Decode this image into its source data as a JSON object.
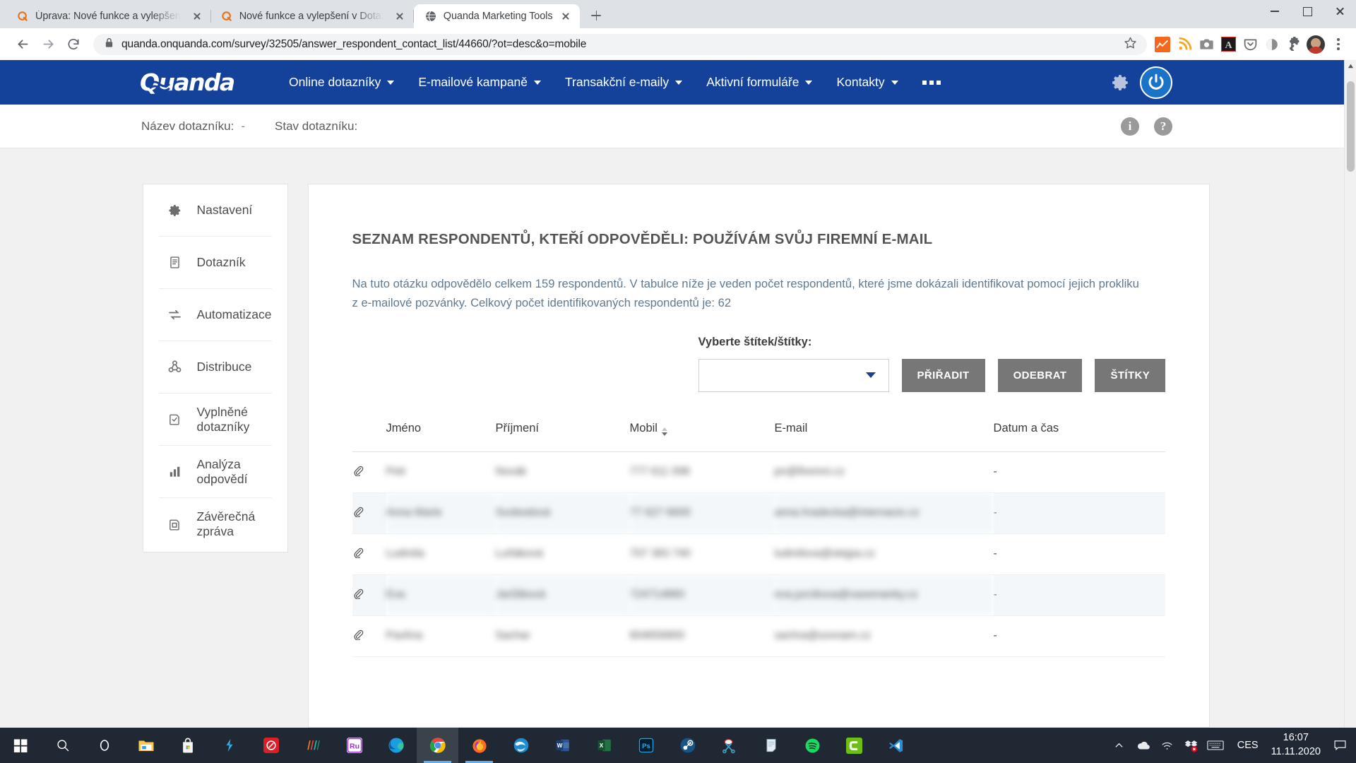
{
  "browser": {
    "tabs": [
      {
        "title": "Úprava: Nové funkce a vylepšení",
        "favicon": "quanda-favicon",
        "active": false
      },
      {
        "title": "Nové funkce a vylepšení v Dotaz",
        "favicon": "quanda-favicon",
        "active": false
      },
      {
        "title": "Quanda Marketing Tools",
        "favicon": "globe-favicon",
        "active": true
      }
    ],
    "new_tab_label": "+",
    "url": "quanda.onquanda.com/survey/32505/answer_respondent_contact_list/44660/?ot=desc&o=mobile",
    "url_host": "quanda.onquanda.com",
    "extensions": [
      "analytics-icon",
      "rss-icon",
      "camera-icon",
      "adobe-acrobat-icon",
      "pocket-icon",
      "moon-icon",
      "puzzle-extensions-icon",
      "profile-avatar-icon",
      "chrome-menu-icon"
    ],
    "window_controls": [
      "minimize",
      "maximize",
      "close"
    ]
  },
  "app": {
    "logo": "Quanda",
    "nav_items": [
      {
        "label": "Online dotazníky",
        "has_dropdown": true
      },
      {
        "label": "E-mailové kampaně",
        "has_dropdown": true
      },
      {
        "label": "Transakční e-maily",
        "has_dropdown": true
      },
      {
        "label": "Aktivní formuláře",
        "has_dropdown": true
      },
      {
        "label": "Kontakty",
        "has_dropdown": true
      },
      {
        "label": "•••",
        "has_dropdown": false
      }
    ],
    "nav_right": [
      "gear-icon",
      "user-power-avatar"
    ],
    "accent_color": "#14429a"
  },
  "subheader": {
    "survey_name_label": "Název dotazníku:",
    "survey_name_value": "-",
    "survey_state_label": "Stav dotazníku:",
    "survey_state_value": "",
    "info_icon": "i",
    "help_icon": "?"
  },
  "sidebar": {
    "items": [
      {
        "label": "Nastavení",
        "icon": "gear-icon"
      },
      {
        "label": "Dotazník",
        "icon": "document-icon"
      },
      {
        "label": "Automatizace",
        "icon": "refresh-cycle-icon"
      },
      {
        "label": "Distribuce",
        "icon": "share-nodes-icon"
      },
      {
        "label": "Vyplněné dotazníky",
        "icon": "checked-document-icon"
      },
      {
        "label": "Analýza odpovědí",
        "icon": "bar-chart-icon"
      },
      {
        "label": "Závěrečná zpráva",
        "icon": "report-document-icon"
      }
    ]
  },
  "main": {
    "title": "SEZNAM RESPONDENTŮ, KTEŘÍ ODPOVĚDĚLI: POUŽÍVÁM SVŮJ FIREMNÍ E-MAIL",
    "description": "Na tuto otázku odpovědělo celkem 159 respondentů. V tabulce níže je veden počet respondentů, které jsme dokázali identifikovat pomocí jejich prokliku z e-mailové pozvánky. Celkový počet identifikovaných respondentů je: 62",
    "total_respondents": "159",
    "identified_respondents": "62",
    "tags": {
      "label": "Vyberte štítek/štítky:",
      "select_value": "",
      "select_placeholder": "",
      "buttons": [
        {
          "label": "PŘIŘADIT",
          "name": "assign-tag-button"
        },
        {
          "label": "ODEBRAT",
          "name": "remove-tag-button"
        },
        {
          "label": "ŠTÍTKY",
          "name": "tags-button"
        }
      ]
    },
    "table": {
      "columns": [
        "",
        "Jméno",
        "Příjmení",
        "Mobil",
        "E-mail",
        "Datum a čas"
      ],
      "sorted_column": "Mobil",
      "sort_direction": "desc",
      "rows": [
        {
          "attach": "paperclip-icon",
          "jmeno": "Petr",
          "prijmeni": "Novák",
          "mobil": "777 611 098",
          "email": "pn@firemni.cz",
          "datum": "-"
        },
        {
          "attach": "paperclip-icon",
          "jmeno": "Anna Marie",
          "prijmeni": "Svobodová",
          "mobil": "77 627 6600",
          "email": "anna.hradecka@internacio.cz",
          "datum": "-"
        },
        {
          "attach": "paperclip-icon",
          "jmeno": "Ludmila",
          "prijmeni": "Luňáková",
          "mobil": "707 383 740",
          "email": "ludmilova@stejpa.cz",
          "datum": "-"
        },
        {
          "attach": "paperclip-icon",
          "jmeno": "Eva",
          "prijmeni": "Jarůšková",
          "mobil": "724714860",
          "email": "eva.jurcikova@vasemanky.cz",
          "datum": "-"
        },
        {
          "attach": "paperclip-icon",
          "jmeno": "Pavlína",
          "prijmeni": "Sachar",
          "mobil": "604656800",
          "email": "sachra@sovnam.cz",
          "datum": "-"
        }
      ]
    }
  },
  "taskbar": {
    "left_icons": [
      "windows-start-icon",
      "search-icon",
      "cortana-icon",
      "file-explorer-icon",
      "microsoft-store-icon",
      "powershell-icon",
      "adobe-creative-cloud-icon",
      "adobe-premiere-rush-bars-icon",
      "adobe-premiere-rush-icon",
      "microsoft-edge-icon",
      "google-chrome-icon",
      "mozilla-firefox-icon",
      "thunderbird-icon",
      "microsoft-word-icon",
      "microsoft-excel-icon",
      "adobe-photoshop-icon",
      "steam-icon",
      "snipping-tool-icon",
      "sticky-notes-icon",
      "spotify-icon",
      "camtasia-icon",
      "visual-studio-code-icon"
    ],
    "tray_icons": [
      "show-hidden-icons-chevron",
      "onedrive-icon",
      "wifi-icon",
      "dropbox-icon",
      "keyboard-icon"
    ],
    "language": "CES",
    "time": "16:07",
    "date": "11.11.2020",
    "notification_icon": "notifications-icon"
  }
}
